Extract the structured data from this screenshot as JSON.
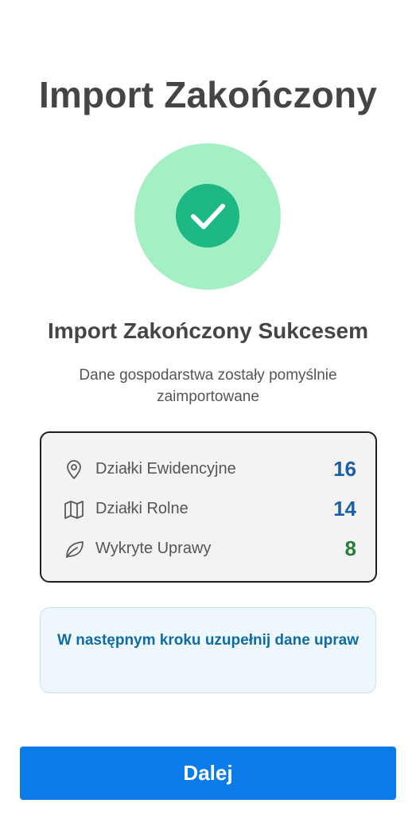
{
  "header": {
    "title": "Import Zakończony"
  },
  "status": {
    "icon": "check-icon",
    "circle_color": "#a4f0c4",
    "badge_color": "#1db883",
    "heading": "Import Zakończony Sukcesem",
    "description": "Dane gospodarstwa zostały pomyślnie zaimportowane"
  },
  "stats": [
    {
      "icon": "map-pin-icon",
      "label": "Działki Ewidencyjne",
      "value": "16",
      "color": "#1b5fa8"
    },
    {
      "icon": "map-icon",
      "label": "Działki Rolne",
      "value": "14",
      "color": "#1b5fa8"
    },
    {
      "icon": "leaf-icon",
      "label": "Wykryte Uprawy",
      "value": "8",
      "color": "#287d3c"
    }
  ],
  "info": {
    "text": "W następnym kroku uzupełnij dane upraw"
  },
  "actions": {
    "next_label": "Dalej",
    "button_color": "#0b7bea"
  }
}
